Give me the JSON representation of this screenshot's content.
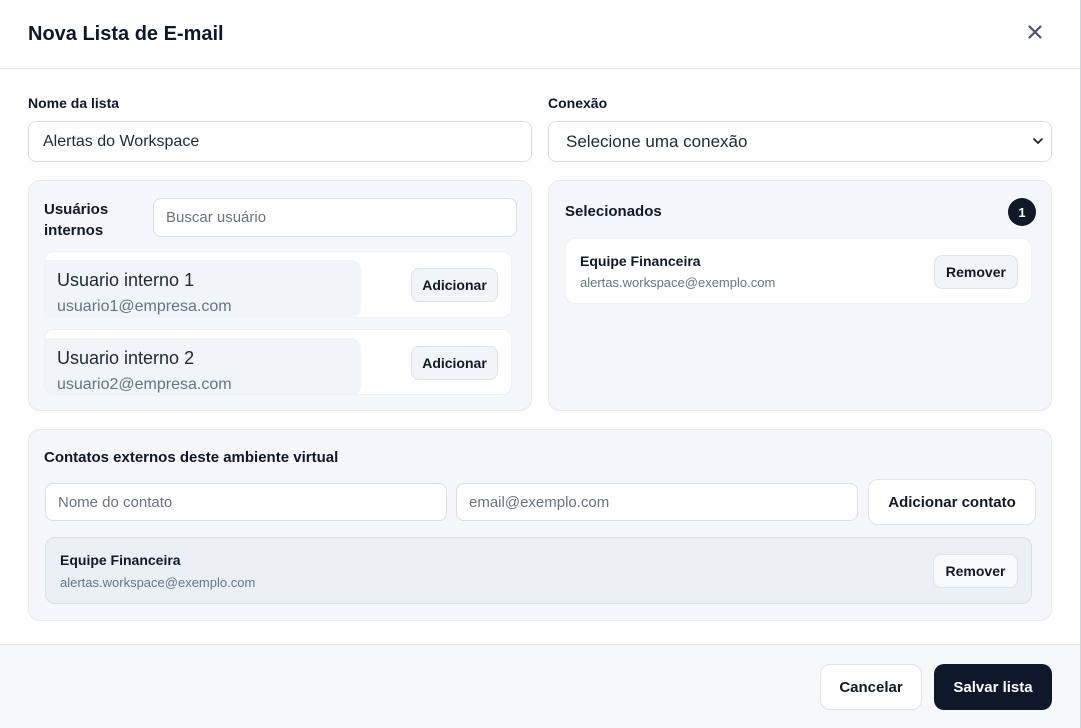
{
  "modal": {
    "title": "Nova Lista de E-mail"
  },
  "form": {
    "list_name_label": "Nome da lista",
    "list_name_value": "Alertas do Workspace",
    "connection_label": "Conexão",
    "connection_value": "Selecione uma conexão"
  },
  "internal_users": {
    "heading_line1": "Usuários",
    "heading_line2": "internos",
    "search_placeholder": "Buscar usuário",
    "add_label": "Adicionar",
    "users": [
      {
        "name": "Usuario interno 1",
        "email": "usuario1@empresa.com"
      },
      {
        "name": "Usuario interno 2",
        "email": "usuario2@empresa.com"
      }
    ]
  },
  "selected": {
    "heading": "Selecionados",
    "count": "1",
    "items": [
      {
        "name": "Equipe Financeira",
        "email": "alertas.workspace@exemplo.com",
        "remove_label": "Remover"
      }
    ]
  },
  "external_contacts": {
    "heading": "Contatos externos deste ambiente virtual",
    "name_placeholder": "Nome do contato",
    "email_placeholder": "email@exemplo.com",
    "add_label": "Adicionar contato",
    "items": [
      {
        "name": "Equipe Financeira",
        "email": "alertas.workspace@exemplo.com",
        "remove_label": "Remover"
      }
    ]
  },
  "footer": {
    "cancel_label": "Cancelar",
    "save_label": "Salvar lista"
  },
  "icons": {
    "close": "close-icon",
    "select": "chevron-down-icon"
  },
  "colors": {
    "primary": "#0f172a",
    "panel": "#f5f7fa",
    "highlight": "#eaf0f6"
  }
}
